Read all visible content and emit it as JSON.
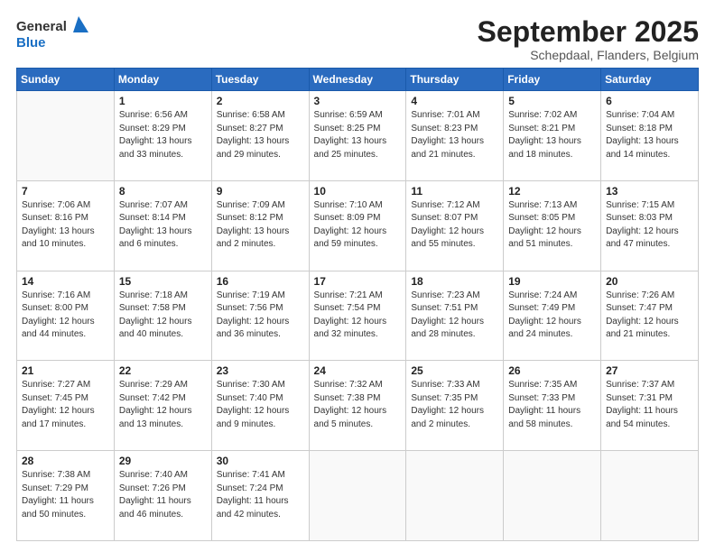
{
  "header": {
    "logo_general": "General",
    "logo_blue": "Blue",
    "month": "September 2025",
    "location": "Schepdaal, Flanders, Belgium"
  },
  "weekdays": [
    "Sunday",
    "Monday",
    "Tuesday",
    "Wednesday",
    "Thursday",
    "Friday",
    "Saturday"
  ],
  "weeks": [
    [
      {
        "day": "",
        "sunrise": "",
        "sunset": "",
        "daylight": ""
      },
      {
        "day": "1",
        "sunrise": "Sunrise: 6:56 AM",
        "sunset": "Sunset: 8:29 PM",
        "daylight": "Daylight: 13 hours and 33 minutes."
      },
      {
        "day": "2",
        "sunrise": "Sunrise: 6:58 AM",
        "sunset": "Sunset: 8:27 PM",
        "daylight": "Daylight: 13 hours and 29 minutes."
      },
      {
        "day": "3",
        "sunrise": "Sunrise: 6:59 AM",
        "sunset": "Sunset: 8:25 PM",
        "daylight": "Daylight: 13 hours and 25 minutes."
      },
      {
        "day": "4",
        "sunrise": "Sunrise: 7:01 AM",
        "sunset": "Sunset: 8:23 PM",
        "daylight": "Daylight: 13 hours and 21 minutes."
      },
      {
        "day": "5",
        "sunrise": "Sunrise: 7:02 AM",
        "sunset": "Sunset: 8:21 PM",
        "daylight": "Daylight: 13 hours and 18 minutes."
      },
      {
        "day": "6",
        "sunrise": "Sunrise: 7:04 AM",
        "sunset": "Sunset: 8:18 PM",
        "daylight": "Daylight: 13 hours and 14 minutes."
      }
    ],
    [
      {
        "day": "7",
        "sunrise": "Sunrise: 7:06 AM",
        "sunset": "Sunset: 8:16 PM",
        "daylight": "Daylight: 13 hours and 10 minutes."
      },
      {
        "day": "8",
        "sunrise": "Sunrise: 7:07 AM",
        "sunset": "Sunset: 8:14 PM",
        "daylight": "Daylight: 13 hours and 6 minutes."
      },
      {
        "day": "9",
        "sunrise": "Sunrise: 7:09 AM",
        "sunset": "Sunset: 8:12 PM",
        "daylight": "Daylight: 13 hours and 2 minutes."
      },
      {
        "day": "10",
        "sunrise": "Sunrise: 7:10 AM",
        "sunset": "Sunset: 8:09 PM",
        "daylight": "Daylight: 12 hours and 59 minutes."
      },
      {
        "day": "11",
        "sunrise": "Sunrise: 7:12 AM",
        "sunset": "Sunset: 8:07 PM",
        "daylight": "Daylight: 12 hours and 55 minutes."
      },
      {
        "day": "12",
        "sunrise": "Sunrise: 7:13 AM",
        "sunset": "Sunset: 8:05 PM",
        "daylight": "Daylight: 12 hours and 51 minutes."
      },
      {
        "day": "13",
        "sunrise": "Sunrise: 7:15 AM",
        "sunset": "Sunset: 8:03 PM",
        "daylight": "Daylight: 12 hours and 47 minutes."
      }
    ],
    [
      {
        "day": "14",
        "sunrise": "Sunrise: 7:16 AM",
        "sunset": "Sunset: 8:00 PM",
        "daylight": "Daylight: 12 hours and 44 minutes."
      },
      {
        "day": "15",
        "sunrise": "Sunrise: 7:18 AM",
        "sunset": "Sunset: 7:58 PM",
        "daylight": "Daylight: 12 hours and 40 minutes."
      },
      {
        "day": "16",
        "sunrise": "Sunrise: 7:19 AM",
        "sunset": "Sunset: 7:56 PM",
        "daylight": "Daylight: 12 hours and 36 minutes."
      },
      {
        "day": "17",
        "sunrise": "Sunrise: 7:21 AM",
        "sunset": "Sunset: 7:54 PM",
        "daylight": "Daylight: 12 hours and 32 minutes."
      },
      {
        "day": "18",
        "sunrise": "Sunrise: 7:23 AM",
        "sunset": "Sunset: 7:51 PM",
        "daylight": "Daylight: 12 hours and 28 minutes."
      },
      {
        "day": "19",
        "sunrise": "Sunrise: 7:24 AM",
        "sunset": "Sunset: 7:49 PM",
        "daylight": "Daylight: 12 hours and 24 minutes."
      },
      {
        "day": "20",
        "sunrise": "Sunrise: 7:26 AM",
        "sunset": "Sunset: 7:47 PM",
        "daylight": "Daylight: 12 hours and 21 minutes."
      }
    ],
    [
      {
        "day": "21",
        "sunrise": "Sunrise: 7:27 AM",
        "sunset": "Sunset: 7:45 PM",
        "daylight": "Daylight: 12 hours and 17 minutes."
      },
      {
        "day": "22",
        "sunrise": "Sunrise: 7:29 AM",
        "sunset": "Sunset: 7:42 PM",
        "daylight": "Daylight: 12 hours and 13 minutes."
      },
      {
        "day": "23",
        "sunrise": "Sunrise: 7:30 AM",
        "sunset": "Sunset: 7:40 PM",
        "daylight": "Daylight: 12 hours and 9 minutes."
      },
      {
        "day": "24",
        "sunrise": "Sunrise: 7:32 AM",
        "sunset": "Sunset: 7:38 PM",
        "daylight": "Daylight: 12 hours and 5 minutes."
      },
      {
        "day": "25",
        "sunrise": "Sunrise: 7:33 AM",
        "sunset": "Sunset: 7:35 PM",
        "daylight": "Daylight: 12 hours and 2 minutes."
      },
      {
        "day": "26",
        "sunrise": "Sunrise: 7:35 AM",
        "sunset": "Sunset: 7:33 PM",
        "daylight": "Daylight: 11 hours and 58 minutes."
      },
      {
        "day": "27",
        "sunrise": "Sunrise: 7:37 AM",
        "sunset": "Sunset: 7:31 PM",
        "daylight": "Daylight: 11 hours and 54 minutes."
      }
    ],
    [
      {
        "day": "28",
        "sunrise": "Sunrise: 7:38 AM",
        "sunset": "Sunset: 7:29 PM",
        "daylight": "Daylight: 11 hours and 50 minutes."
      },
      {
        "day": "29",
        "sunrise": "Sunrise: 7:40 AM",
        "sunset": "Sunset: 7:26 PM",
        "daylight": "Daylight: 11 hours and 46 minutes."
      },
      {
        "day": "30",
        "sunrise": "Sunrise: 7:41 AM",
        "sunset": "Sunset: 7:24 PM",
        "daylight": "Daylight: 11 hours and 42 minutes."
      },
      {
        "day": "",
        "sunrise": "",
        "sunset": "",
        "daylight": ""
      },
      {
        "day": "",
        "sunrise": "",
        "sunset": "",
        "daylight": ""
      },
      {
        "day": "",
        "sunrise": "",
        "sunset": "",
        "daylight": ""
      },
      {
        "day": "",
        "sunrise": "",
        "sunset": "",
        "daylight": ""
      }
    ]
  ]
}
